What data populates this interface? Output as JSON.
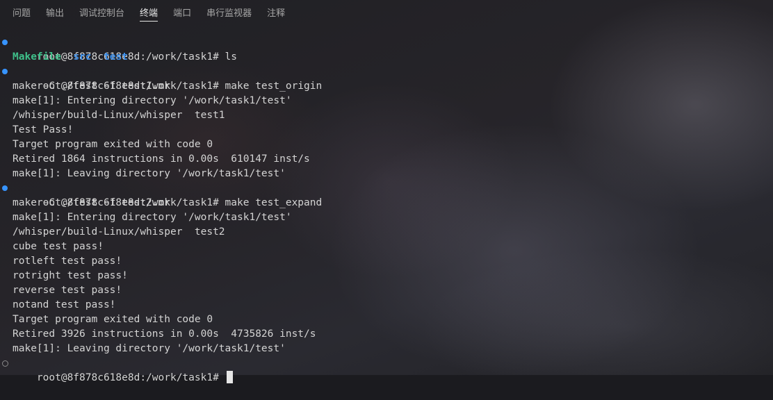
{
  "tabs": [
    {
      "label": "问题",
      "active": false
    },
    {
      "label": "输出",
      "active": false
    },
    {
      "label": "调试控制台",
      "active": false
    },
    {
      "label": "终端",
      "active": true
    },
    {
      "label": "端口",
      "active": false
    },
    {
      "label": "串行监视器",
      "active": false
    },
    {
      "label": "注释",
      "active": false
    }
  ],
  "colors": {
    "prompt_marker": "#3794ff",
    "ls_file": "#3fc08a",
    "ls_dir": "#3b8eea"
  },
  "terminal": {
    "prompt1": "root@8f878c618e8d:/work/task1# ls",
    "ls_makefile": "Makefile",
    "ls_src": "src",
    "ls_test": "test",
    "prompt2": "root@8f878c618e8d:/work/task1# make test_origin",
    "l3": "make -C ./test -f test1.mk",
    "l4": "make[1]: Entering directory '/work/task1/test'",
    "l5": "/whisper/build-Linux/whisper  test1",
    "l6": "Test Pass!",
    "l7": "Target program exited with code 0",
    "l8": "Retired 1864 instructions in 0.00s  610147 inst/s",
    "l9": "make[1]: Leaving directory '/work/task1/test'",
    "prompt3": "root@8f878c618e8d:/work/task1# make test_expand",
    "l11": "make -C ./test -f test2.mk",
    "l12": "make[1]: Entering directory '/work/task1/test'",
    "l13": "/whisper/build-Linux/whisper  test2",
    "l14": "cube test pass!",
    "l15": "rotleft test pass!",
    "l16": "rotright test pass!",
    "l17": "reverse test pass!",
    "l18": "notand test pass!",
    "l19": "Target program exited with code 0",
    "l20": "Retired 3926 instructions in 0.00s  4735826 inst/s",
    "l21": "make[1]: Leaving directory '/work/task1/test'",
    "prompt4": "root@8f878c618e8d:/work/task1# "
  }
}
